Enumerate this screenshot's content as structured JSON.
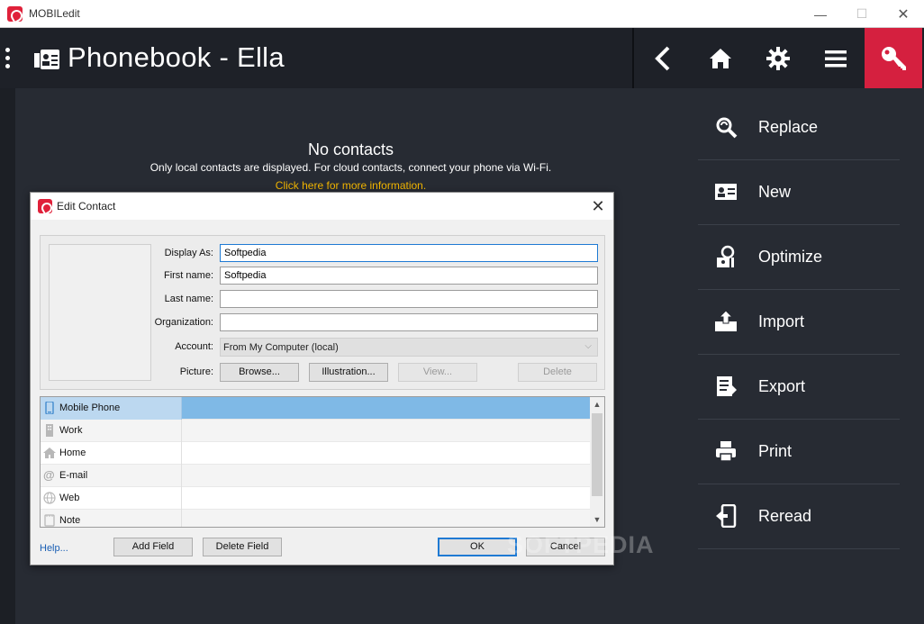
{
  "window": {
    "title": "MOBILedit",
    "minimize": "—",
    "maximize": "☐",
    "close": "✕"
  },
  "header": {
    "title": "Phonebook - Ella"
  },
  "main": {
    "empty_title": "No contacts",
    "empty_subtitle": "Only local contacts are displayed. For cloud contacts, connect your phone via Wi-Fi.",
    "info_link": "Click here for more information."
  },
  "actions": [
    {
      "label": "Replace",
      "icon": "replace-icon"
    },
    {
      "label": "New",
      "icon": "new-contact-icon"
    },
    {
      "label": "Optimize",
      "icon": "optimize-icon"
    },
    {
      "label": "Import",
      "icon": "import-icon"
    },
    {
      "label": "Export",
      "icon": "export-icon"
    },
    {
      "label": "Print",
      "icon": "print-icon"
    },
    {
      "label": "Reread",
      "icon": "reread-icon"
    }
  ],
  "dialog": {
    "title": "Edit Contact",
    "close": "✕",
    "labels": {
      "display_as": "Display As:",
      "first_name": "First name:",
      "last_name": "Last name:",
      "organization": "Organization:",
      "account": "Account:",
      "picture": "Picture:"
    },
    "values": {
      "display_as": "Softpedia",
      "first_name": "Softpedia",
      "last_name": "",
      "organization": "",
      "account": "From My Computer (local)"
    },
    "picture_buttons": {
      "browse": "Browse...",
      "illustration": "Illustration...",
      "view": "View...",
      "delete": "Delete"
    },
    "fields": [
      {
        "name": "Mobile Phone",
        "icon": "mobile-phone-icon"
      },
      {
        "name": "Work",
        "icon": "work-icon"
      },
      {
        "name": "Home",
        "icon": "home-icon"
      },
      {
        "name": "E-mail",
        "icon": "email-icon"
      },
      {
        "name": "Web",
        "icon": "web-icon"
      },
      {
        "name": "Note",
        "icon": "note-icon"
      }
    ],
    "help": "Help...",
    "add_field": "Add Field",
    "delete_field": "Delete Field",
    "ok": "OK",
    "cancel": "Cancel"
  },
  "watermark": "SOFTPEDIA",
  "colors": {
    "accent": "#d5203f",
    "link": "#f0b400",
    "selection": "#7fb9e6"
  }
}
